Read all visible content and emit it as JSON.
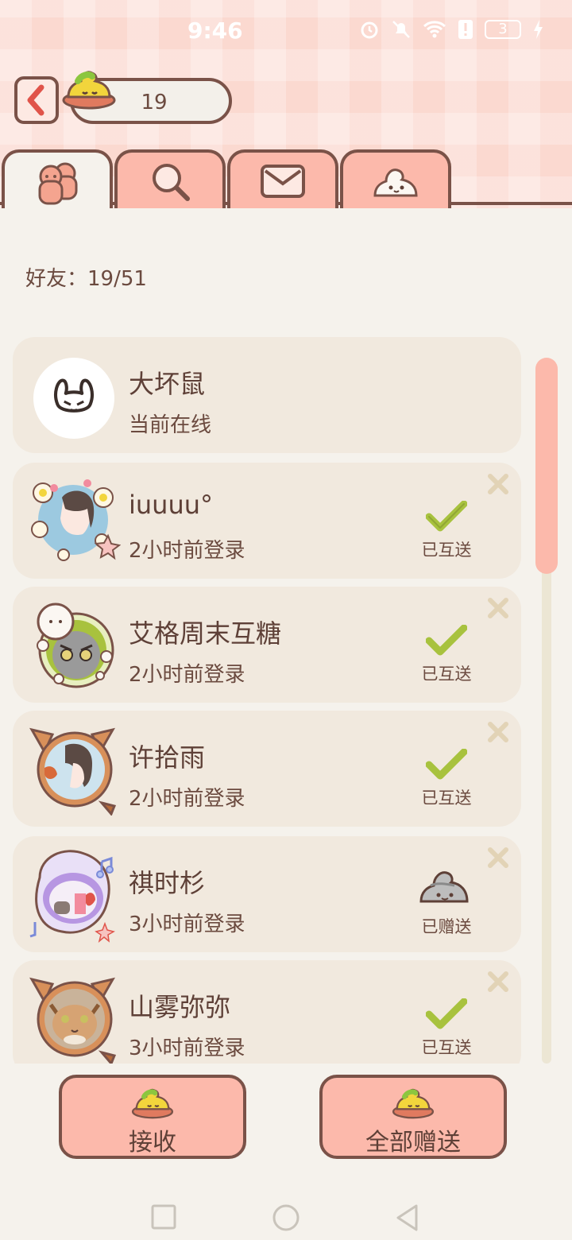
{
  "status": {
    "time": "9:46",
    "battery": "3"
  },
  "header": {
    "currency_value": "19"
  },
  "tabs": [
    {
      "name": "friends",
      "icon": "friends-icon"
    },
    {
      "name": "search",
      "icon": "search-icon"
    },
    {
      "name": "mail",
      "icon": "mail-icon"
    },
    {
      "name": "candy",
      "icon": "candy-icon"
    }
  ],
  "friends_count_label": "好友：19/51",
  "friends": [
    {
      "name": "大坏鼠",
      "status": "当前在线",
      "gift": ""
    },
    {
      "name": "iuuuu°",
      "status": "2小时前登录",
      "gift": "已互送"
    },
    {
      "name": "艾格周末互糖",
      "status": "2小时前登录",
      "gift": "已互送"
    },
    {
      "name": "许拾雨",
      "status": "2小时前登录",
      "gift": "已互送"
    },
    {
      "name": "祺时杉",
      "status": "3小时前登录",
      "gift": "已赠送"
    },
    {
      "name": "山雾弥弥",
      "status": "3小时前登录",
      "gift": "已互送"
    }
  ],
  "buttons": {
    "receive": "接收",
    "send_all": "全部赠送"
  },
  "colors": {
    "accent": "#fcb9ab",
    "outline": "#7a5248",
    "card": "#f1e9de",
    "check": "#a8c23e"
  }
}
